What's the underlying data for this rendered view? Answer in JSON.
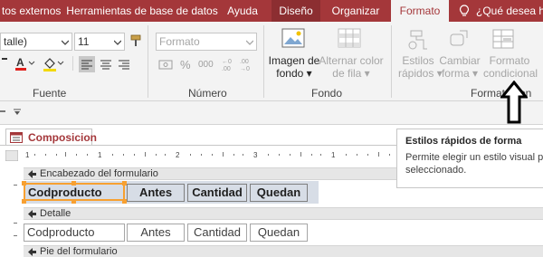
{
  "tabs": [
    {
      "label": "tos externos"
    },
    {
      "label": "Herramientas de base de datos"
    },
    {
      "label": "Ayuda"
    },
    {
      "label": "Diseño"
    },
    {
      "label": "Organizar"
    },
    {
      "label": "Formato"
    },
    {
      "label": "¿Qué desea ha"
    }
  ],
  "ribbon": {
    "font_combo_value": "talle)",
    "size_combo_value": "11",
    "format_combo_value": "Formato",
    "groups": {
      "fuente": "Fuente",
      "numero": "Número",
      "fondo": "Fondo",
      "formato_cond": "Formato con"
    },
    "percent_symbol": "%",
    "thousands_symbol": "000",
    "background_image_label": [
      "Imagen de",
      "fondo"
    ],
    "alt_row_color_label": [
      "Alternar color",
      "de fila"
    ],
    "quick_styles_label": [
      "Estilos",
      "rápidos"
    ],
    "change_shape_label": [
      "Cambiar",
      "forma"
    ],
    "conditional_format_label": [
      "Formato",
      "condicional"
    ]
  },
  "document": {
    "tab_title": "Composicion",
    "sections": {
      "header": "Encabezado del formulario",
      "detail": "Detalle",
      "footer": "Pie del formulario"
    },
    "header_labels": [
      "Codproducto",
      "Antes",
      "Cantidad",
      "Quedan"
    ],
    "detail_fields": [
      "Codproducto",
      "Antes",
      "Cantidad",
      "Quedan"
    ]
  },
  "tooltip": {
    "title": "Estilos rápidos de forma",
    "body": "Permite elegir un estilo visual p seleccionado."
  },
  "colors": {
    "accent": "#a4373a",
    "selection": "#f7a031",
    "label_fill": "#d7dde6"
  }
}
